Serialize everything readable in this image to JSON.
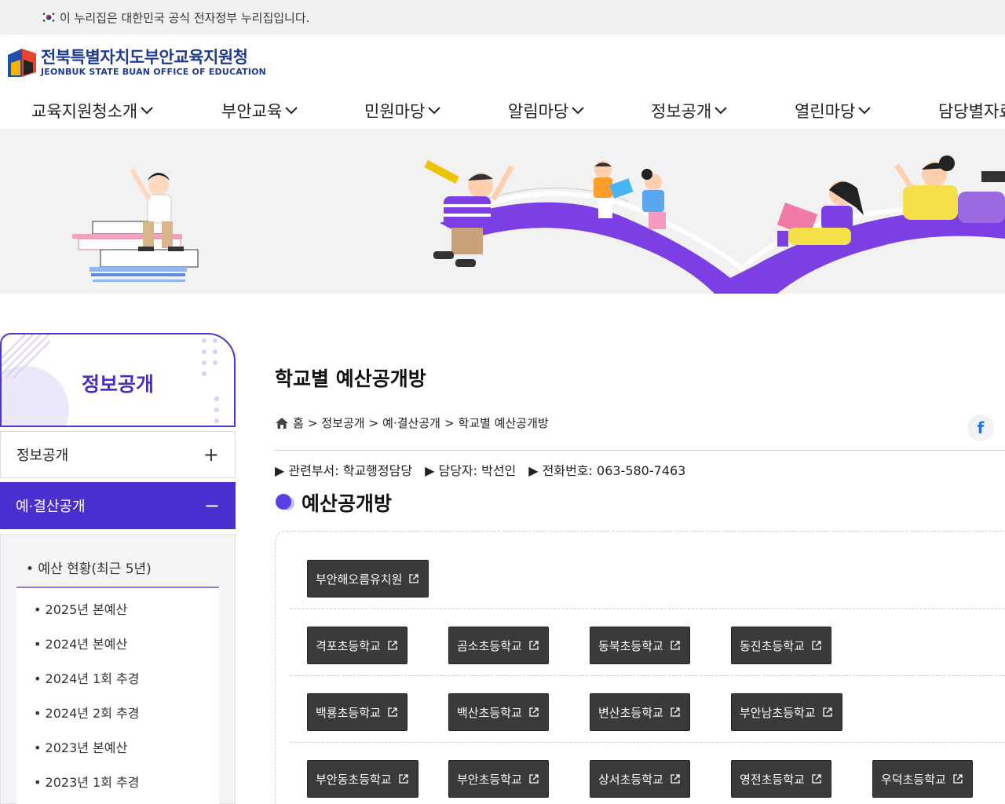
{
  "gov_banner": {
    "text": "이 누리집은 대한민국 공식 전자정부 누리집입니다."
  },
  "logo": {
    "ko": "전북특별자치도부안교육지원청",
    "en": "JEONBUK STATE BUAN OFFICE OF EDUCATION"
  },
  "nav": [
    {
      "label": "교육지원청소개"
    },
    {
      "label": "부안교육"
    },
    {
      "label": "민원마당"
    },
    {
      "label": "알림마당"
    },
    {
      "label": "정보공개"
    },
    {
      "label": "열린마당"
    },
    {
      "label": "담당별자료"
    }
  ],
  "sidebar": {
    "title": "정보공개",
    "items": [
      {
        "label": "정보공개",
        "toggle": "+"
      },
      {
        "label": "예·결산공개",
        "toggle": "−"
      }
    ],
    "sub_head": "• 예산 현황(최근 5년)",
    "sub_items": [
      "• 2025년 본예산",
      "• 2024년 본예산",
      "• 2024년 1회 추경",
      "• 2024년 2회 추경",
      "• 2023년 본예산",
      "• 2023년 1회 추경"
    ]
  },
  "content": {
    "title": "학교별 예산공개방",
    "breadcrumb": [
      "홈",
      ">",
      "정보공개",
      ">",
      "예·결산공개",
      ">",
      "학교별 예산공개방"
    ],
    "facebook_label": "f",
    "meta": {
      "dept": "▶ 관련부서: 학교행정담당",
      "manager": "▶ 담당자: 박선인",
      "phone": "▶ 전화번호: 063-580-7463"
    },
    "section_title": "예산공개방",
    "schools": [
      [
        "부안해오름유치원"
      ],
      [
        "격포초등학교",
        "곰소초등학교",
        "동북초등학교",
        "동진초등학교"
      ],
      [
        "백룡초등학교",
        "백산초등학교",
        "변산초등학교",
        "부안남초등학교"
      ],
      [
        "부안동초등학교",
        "부안초등학교",
        "상서초등학교",
        "영전초등학교",
        "우덕초등학교"
      ]
    ]
  },
  "colors": {
    "accent": "#4a2fd0",
    "brand": "#1f3b8f",
    "button": "#3a3a3a"
  }
}
